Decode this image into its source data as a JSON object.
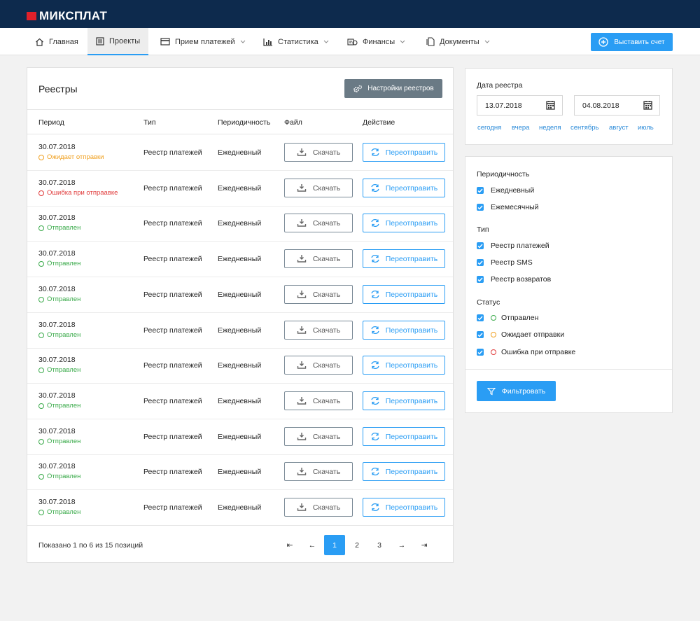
{
  "brand": {
    "name": "МИКСПЛАТ"
  },
  "nav": {
    "items": [
      {
        "label": "Главная",
        "icon": "home-icon"
      },
      {
        "label": "Проекты",
        "icon": "projects-icon",
        "active": true
      },
      {
        "label": "Прием платежей",
        "icon": "card-icon",
        "dropdown": true
      },
      {
        "label": "Статистика",
        "icon": "chart-icon",
        "dropdown": true
      },
      {
        "label": "Финансы",
        "icon": "finance-icon",
        "dropdown": true
      },
      {
        "label": "Документы",
        "icon": "document-icon",
        "dropdown": true
      }
    ],
    "invoice_button": "Выставить счет"
  },
  "registry": {
    "title": "Реестры",
    "settings_button": "Настройки реестров",
    "columns": [
      "Период",
      "Тип",
      "Периодичность",
      "Файл",
      "Действие"
    ],
    "download_label": "Скачать",
    "resend_label": "Переотправить",
    "rows": [
      {
        "date": "30.07.2018",
        "status": "Ожидает отправки",
        "status_type": "pending",
        "type": "Реестр платежей",
        "period": "Ежедневный"
      },
      {
        "date": "30.07.2018",
        "status": "Ошибка при отпраавке",
        "status_type": "error",
        "type": "Реестр платежей",
        "period": "Ежедневный"
      },
      {
        "date": "30.07.2018",
        "status": "Отправлен",
        "status_type": "sent",
        "type": "Реестр платежей",
        "period": "Ежедневный"
      },
      {
        "date": "30.07.2018",
        "status": "Отправлен",
        "status_type": "sent",
        "type": "Реестр платежей",
        "period": "Ежедневный"
      },
      {
        "date": "30.07.2018",
        "status": "Отправлен",
        "status_type": "sent",
        "type": "Реестр платежей",
        "period": "Ежедневный"
      },
      {
        "date": "30.07.2018",
        "status": "Отправлен",
        "status_type": "sent",
        "type": "Реестр платежей",
        "period": "Ежедневный"
      },
      {
        "date": "30.07.2018",
        "status": "Отправлен",
        "status_type": "sent",
        "type": "Реестр платежей",
        "period": "Ежедневный"
      },
      {
        "date": "30.07.2018",
        "status": "Отправлен",
        "status_type": "sent",
        "type": "Реестр платежей",
        "period": "Ежедневный"
      },
      {
        "date": "30.07.2018",
        "status": "Отправлен",
        "status_type": "sent",
        "type": "Реестр платежей",
        "period": "Ежедневный"
      },
      {
        "date": "30.07.2018",
        "status": "Отправлен",
        "status_type": "sent",
        "type": "Реестр платежей",
        "period": "Ежедневный"
      },
      {
        "date": "30.07.2018",
        "status": "Отправлен",
        "status_type": "sent",
        "type": "Реестр платежей",
        "period": "Ежедневный"
      }
    ],
    "shown_text": "Показано 1 по 6 из 15 позиций",
    "pagination": {
      "first": "⇤",
      "prev": "←",
      "pages": [
        "1",
        "2",
        "3"
      ],
      "current": "1",
      "next": "→",
      "last": "⇥"
    }
  },
  "date_filter": {
    "title": "Дата реестра",
    "from": "13.07.2018",
    "to": "04.08.2018",
    "quick_links": [
      "сегодня",
      "вчера",
      "неделя",
      "сентябрь",
      "август",
      "июль"
    ]
  },
  "filters": {
    "periodicity_title": "Периодичность",
    "periodicity": [
      "Ежедневный",
      "Ежемесячный"
    ],
    "type_title": "Тип",
    "types": [
      "Реестр платежей",
      "Реестр SMS",
      "Реестр возвратов"
    ],
    "status_title": "Статус",
    "statuses": [
      {
        "label": "Отправлен",
        "status_type": "sent"
      },
      {
        "label": "Ожидает отправки",
        "status_type": "pending"
      },
      {
        "label": "Ошибка при отправке",
        "status_type": "error"
      }
    ],
    "button": "Фильтровать"
  },
  "colors": {
    "header_bg": "#0d2a4d",
    "brand_red": "#e0202a",
    "accent": "#2a9df4",
    "settings_bg": "#6a7a85",
    "status_sent": "#3aaa4a",
    "status_pending": "#f0a020",
    "status_error": "#e03a3a"
  }
}
